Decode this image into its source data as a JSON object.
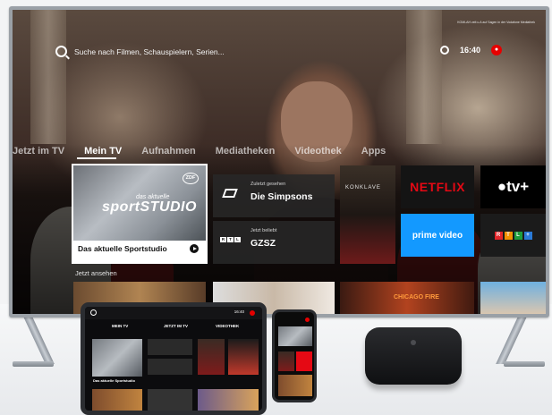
{
  "tv": {
    "search_placeholder": "Suche nach Filmen, Schauspielern, Serien...",
    "top_note": "KOMLAH zeit u.A auf Sagen in der Vodafone Mediathek",
    "time": "16:40",
    "nav": [
      "Jetzt im TV",
      "Mein TV",
      "Aufnahmen",
      "Mediatheken",
      "Videothek",
      "Apps"
    ],
    "active_nav": "Mein TV",
    "featured": {
      "channel": "ZDF",
      "small_title": "das aktuelle",
      "big_title": "sportSTUDIO",
      "caption": "Das aktuelle Sportstudio"
    },
    "recent": {
      "label": "Zuletzt gesehen",
      "title": "Die Simpsons"
    },
    "popular": {
      "label": "Jetzt beliebt",
      "title": "GZSZ"
    },
    "rtl_letters": [
      "R",
      "T",
      "L"
    ],
    "poster_title": "KONKLAVE",
    "apps": {
      "netflix": "NETFLIX",
      "appletv": "tv+",
      "prime": "prime video",
      "rtlplus": [
        "R",
        "T",
        "L",
        "+"
      ]
    },
    "now_label": "Jetzt ansehen",
    "thumb_text": "CHICAGO FIRE"
  },
  "tablet": {
    "tabs": [
      "MEIN TV",
      "JETZT IM TV",
      "VIDEOTHEK"
    ],
    "time": "16:40",
    "feature_caption": "Das aktuelle Sportstudio"
  },
  "colors": {
    "vodafone_red": "#e60000",
    "netflix_red": "#e50914",
    "prime_blue": "#1399ff"
  }
}
